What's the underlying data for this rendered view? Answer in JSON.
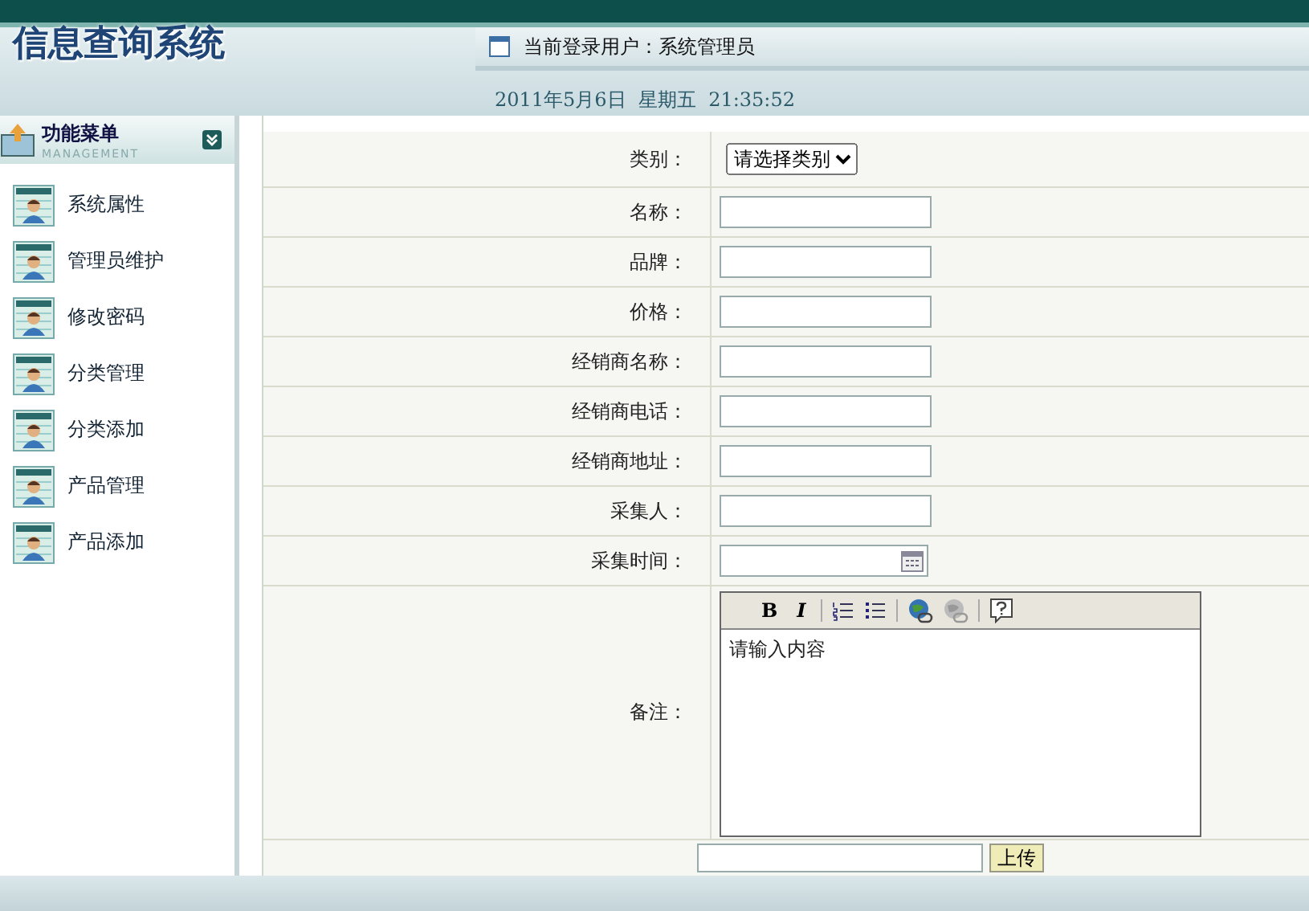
{
  "header": {
    "title": "信息查询系统",
    "user": "当前登录用户：系统管理员",
    "datetime": "2011年5月6日  星期五  21:35:52"
  },
  "sidebar": {
    "title": "功能菜单",
    "subtitle": "MANAGEMENT",
    "items": [
      {
        "label": "系统属性"
      },
      {
        "label": "管理员维护"
      },
      {
        "label": "修改密码"
      },
      {
        "label": "分类管理"
      },
      {
        "label": "分类添加"
      },
      {
        "label": "产品管理"
      },
      {
        "label": "产品添加"
      }
    ]
  },
  "form": {
    "rows": [
      {
        "kind": "select",
        "label": "类别：",
        "value": "请选择类别"
      },
      {
        "kind": "text",
        "label": "名称："
      },
      {
        "kind": "text",
        "label": "品牌："
      },
      {
        "kind": "text",
        "label": "价格："
      },
      {
        "kind": "text",
        "label": "经销商名称："
      },
      {
        "kind": "text",
        "label": "经销商电话："
      },
      {
        "kind": "text",
        "label": "经销商地址："
      },
      {
        "kind": "text",
        "label": "采集人："
      },
      {
        "kind": "date",
        "label": "采集时间："
      },
      {
        "kind": "editor",
        "label": "备注：",
        "value": "请输入内容",
        "toolbar": [
          "B",
          "I"
        ]
      },
      {
        "kind": "file",
        "button": "上传"
      }
    ]
  }
}
